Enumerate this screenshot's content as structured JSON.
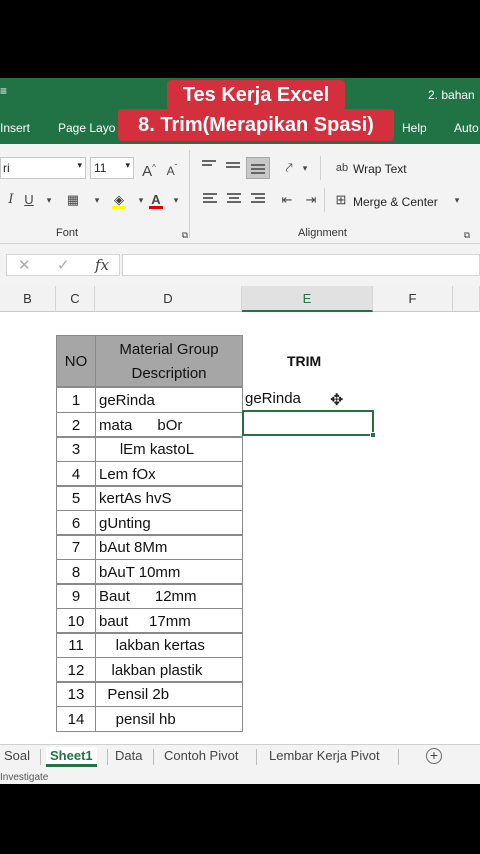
{
  "overlay": {
    "line1": "Tes Kerja Excel",
    "line2": "8. Trim(Merapikan Spasi)"
  },
  "window": {
    "filename": "2. bahan"
  },
  "ribbon_tabs": {
    "insert": "Insert",
    "page_layout": "Page Layo",
    "help": "Help",
    "auto": "Auto"
  },
  "font": {
    "name": "ri",
    "size": "11",
    "group_label": "Font"
  },
  "alignment": {
    "wrap_text": "Wrap Text",
    "merge_center": "Merge & Center",
    "group_label": "Alignment"
  },
  "formula_bar": {
    "cancel": "✕",
    "enter": "✓",
    "fx": "fx",
    "value": ""
  },
  "columns": [
    "B",
    "C",
    "D",
    "E",
    "F"
  ],
  "table": {
    "header_no": "NO",
    "header_desc_line1": "Material Group",
    "header_desc_line2": "Description",
    "rows": [
      {
        "no": "1",
        "desc": "geRinda"
      },
      {
        "no": "2",
        "desc": "mata      bOr"
      },
      {
        "no": "3",
        "desc": "     lEm kastoL"
      },
      {
        "no": "4",
        "desc": "Lem fOx"
      },
      {
        "no": "5",
        "desc": "kertAs hvS"
      },
      {
        "no": "6",
        "desc": "gUnting"
      },
      {
        "no": "7",
        "desc": "bAut 8Mm"
      },
      {
        "no": "8",
        "desc": "bAuT 10mm"
      },
      {
        "no": "9",
        "desc": "Baut      12mm"
      },
      {
        "no": "10",
        "desc": "baut     17mm"
      },
      {
        "no": "11",
        "desc": "    lakban kertas"
      },
      {
        "no": "12",
        "desc": "   lakban plastik"
      },
      {
        "no": "13",
        "desc": "  Pensil 2b"
      },
      {
        "no": "14",
        "desc": "    pensil hb"
      }
    ]
  },
  "trim": {
    "header": "TRIM",
    "result_row1": "geRinda"
  },
  "sheet_tabs": [
    "Soal",
    "Sheet1",
    "Data",
    "Contoh Pivot",
    "Lembar Kerja Pivot"
  ],
  "status": "Investigate"
}
